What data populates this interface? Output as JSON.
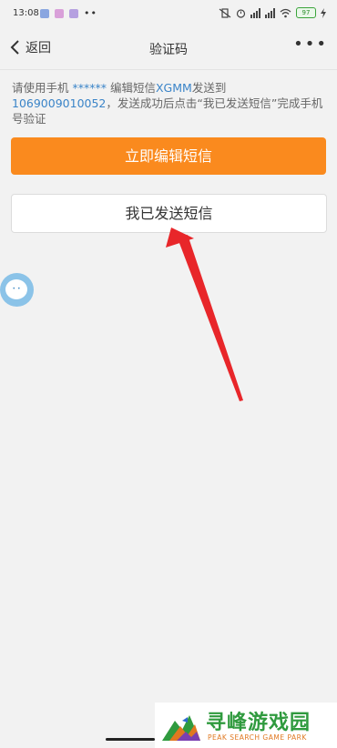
{
  "status_bar": {
    "time": "13:08",
    "battery": "97"
  },
  "nav": {
    "back_label": "返回",
    "title": "验证码",
    "more": "•••"
  },
  "instruction": {
    "p1": "请使用手机 ",
    "masked_phone": "******",
    "p2": " 编辑短信",
    "code": "XGMM",
    "p3": "发送到",
    "number": "1069009010052",
    "p4": "，发送成功后点击“我已发送短信”完成手机号验证"
  },
  "buttons": {
    "edit_sms": "立即编辑短信",
    "sent_sms": "我已发送短信"
  },
  "watermark": {
    "title": "寻峰游戏园",
    "subtitle": "PEAK SEARCH GAME PARK"
  },
  "colors": {
    "accent_orange": "#fa8a1e",
    "link_blue": "#3a84c8",
    "arrow_red": "#e8262a"
  }
}
